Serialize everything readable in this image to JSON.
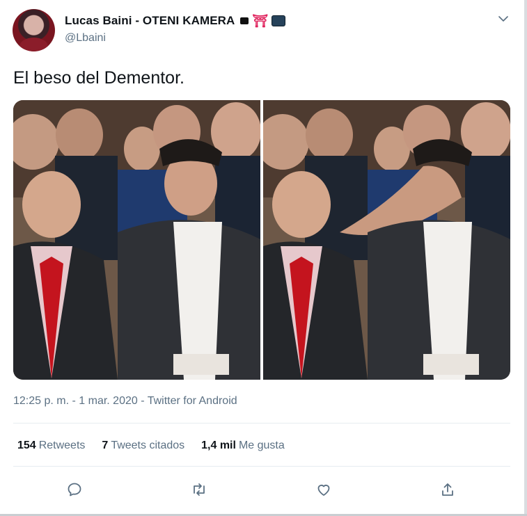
{
  "tweet": {
    "author": {
      "display_name": "Lucas Baini - OTENI KAMERA",
      "name_emojis": [
        "camera-emoji",
        "torii-gate-emoji",
        "camera-with-flash-emoji"
      ],
      "handle": "@Lbaini"
    },
    "text": "El beso del Dementor.",
    "media_alt": [
      "photo-original",
      "photo-edited"
    ],
    "meta": "12:25 p. m. - 1 mar. 2020 - Twitter for Android",
    "stats": {
      "retweets_count": "154",
      "retweets_label": "Retweets",
      "quotes_count": "7",
      "quotes_label": "Tweets citados",
      "likes_count": "1,4 mil",
      "likes_label": "Me gusta"
    },
    "actions": [
      "reply-icon",
      "retweet-icon",
      "like-icon",
      "share-icon"
    ],
    "more_icon": "chevron-down-icon"
  }
}
